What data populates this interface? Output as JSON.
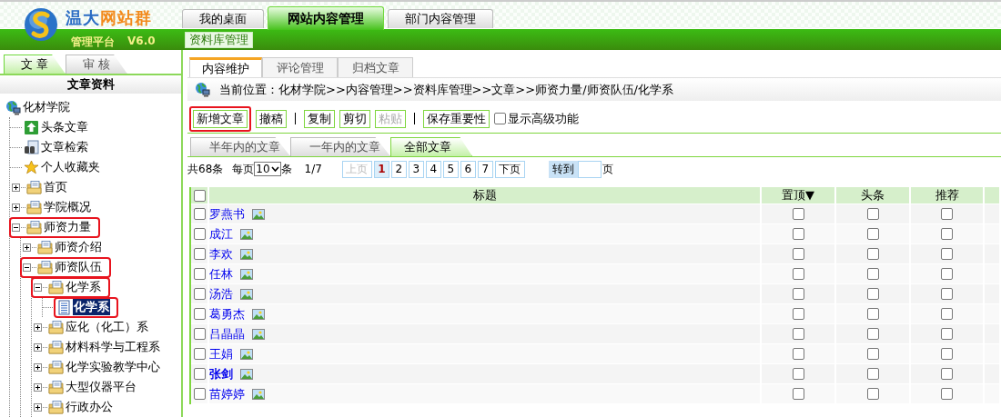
{
  "brand": {
    "name": [
      "温大",
      "网站群"
    ],
    "subtitle": "管理平台",
    "version": "V6.0"
  },
  "top_tabs": [
    {
      "label": "我的桌面",
      "selected": false
    },
    {
      "label": "网站内容管理",
      "selected": true
    },
    {
      "label": "部门内容管理",
      "selected": false
    }
  ],
  "sub_nav": [
    "资料库管理"
  ],
  "sidebar": {
    "tabs": [
      {
        "label": "文 章",
        "selected": true
      },
      {
        "label": "审 核",
        "selected": false
      }
    ],
    "heading": "文章资料",
    "tree": [
      {
        "label": "化材学院",
        "kind": "globe",
        "selected": false,
        "children": [
          {
            "label": "头条文章",
            "kind": "top",
            "highlighted": false,
            "selected": false
          },
          {
            "label": "文章检索",
            "kind": "search",
            "highlighted": false,
            "selected": false
          },
          {
            "label": "个人收藏夹",
            "kind": "star",
            "highlighted": false,
            "selected": false
          },
          {
            "label": "首页",
            "kind": "folder",
            "expanded": false,
            "highlighted": false,
            "selected": false
          },
          {
            "label": "学院概况",
            "kind": "folder",
            "expanded": false,
            "highlighted": false,
            "selected": false
          },
          {
            "label": "师资力量",
            "kind": "folder",
            "expanded": true,
            "highlighted": true,
            "selected": false,
            "children": [
              {
                "label": "师资介绍",
                "kind": "folder",
                "expanded": false,
                "highlighted": false,
                "selected": false
              },
              {
                "label": "师资队伍",
                "kind": "folder",
                "expanded": true,
                "highlighted": true,
                "selected": false,
                "children": [
                  {
                    "label": "化学系",
                    "kind": "folder",
                    "expanded": true,
                    "highlighted": true,
                    "selected": false,
                    "children": [
                      {
                        "label": "化学系",
                        "kind": "doc",
                        "highlighted": true,
                        "selected": true
                      }
                    ]
                  },
                  {
                    "label": "应化（化工）系",
                    "kind": "folder",
                    "expanded": false,
                    "highlighted": false,
                    "selected": false
                  },
                  {
                    "label": "材料科学与工程系",
                    "kind": "folder",
                    "expanded": false,
                    "highlighted": false,
                    "selected": false
                  },
                  {
                    "label": "化学实验教学中心",
                    "kind": "folder",
                    "expanded": false,
                    "highlighted": false,
                    "selected": false
                  },
                  {
                    "label": "大型仪器平台",
                    "kind": "folder",
                    "expanded": false,
                    "highlighted": false,
                    "selected": false
                  },
                  {
                    "label": "行政办公",
                    "kind": "folder",
                    "expanded": false,
                    "highlighted": false,
                    "selected": false
                  }
                ]
              }
            ]
          }
        ]
      }
    ]
  },
  "content_tabs": [
    {
      "label": "内容维护",
      "selected": true
    },
    {
      "label": "评论管理",
      "selected": false
    },
    {
      "label": "归档文章",
      "selected": false
    }
  ],
  "breadcrumb": "当前位置：化材学院>>内容管理>>资料库管理>>文章>>师资力量/师资队伍/化学系",
  "toolbar": [
    {
      "kind": "button",
      "label": "新增文章",
      "highlighted": true,
      "disabled": false
    },
    {
      "kind": "button",
      "label": "撤稿",
      "highlighted": false,
      "disabled": false
    },
    {
      "kind": "separator"
    },
    {
      "kind": "button",
      "label": "复制",
      "highlighted": false,
      "disabled": false
    },
    {
      "kind": "button",
      "label": "剪切",
      "highlighted": false,
      "disabled": false
    },
    {
      "kind": "button",
      "label": "粘贴",
      "highlighted": false,
      "disabled": true
    },
    {
      "kind": "separator"
    },
    {
      "kind": "button",
      "label": "保存重要性",
      "highlighted": false,
      "disabled": false
    },
    {
      "kind": "checkbox",
      "label": "显示高级功能",
      "checked": false
    }
  ],
  "range_tabs": [
    {
      "label": "半年内的文章",
      "selected": false
    },
    {
      "label": "一年内的文章",
      "selected": false
    },
    {
      "label": "全部文章",
      "selected": true
    }
  ],
  "pagination": {
    "total": "共68条",
    "per_page_label": "每页",
    "per_page": "10",
    "per_page_unit": "条",
    "position": "1/7",
    "prev": {
      "label": "上页",
      "disabled": true
    },
    "pages": [
      {
        "label": "1",
        "selected": true
      },
      {
        "label": "2",
        "selected": false
      },
      {
        "label": "3",
        "selected": false
      },
      {
        "label": "4",
        "selected": false
      },
      {
        "label": "5",
        "selected": false
      },
      {
        "label": "6",
        "selected": false
      },
      {
        "label": "7",
        "selected": false
      }
    ],
    "next": {
      "label": "下页",
      "disabled": false
    },
    "goto": "转到",
    "goto_unit": "页"
  },
  "table": {
    "select_all": false,
    "columns": [
      "标题",
      "置顶▼",
      "头条",
      "推荐"
    ],
    "rows": [
      {
        "checked": false,
        "title": "罗燕书",
        "bold": false,
        "top": false,
        "headline": false,
        "recommend": false
      },
      {
        "checked": false,
        "title": "成江",
        "bold": false,
        "top": false,
        "headline": false,
        "recommend": false
      },
      {
        "checked": false,
        "title": "李欢",
        "bold": false,
        "top": false,
        "headline": false,
        "recommend": false
      },
      {
        "checked": false,
        "title": "任林",
        "bold": false,
        "top": false,
        "headline": false,
        "recommend": false
      },
      {
        "checked": false,
        "title": "汤浩",
        "bold": false,
        "top": false,
        "headline": false,
        "recommend": false
      },
      {
        "checked": false,
        "title": "葛勇杰",
        "bold": false,
        "top": false,
        "headline": false,
        "recommend": false
      },
      {
        "checked": false,
        "title": "吕晶晶",
        "bold": false,
        "top": false,
        "headline": false,
        "recommend": false
      },
      {
        "checked": false,
        "title": "王娟",
        "bold": false,
        "top": false,
        "headline": false,
        "recommend": false
      },
      {
        "checked": false,
        "title": "张剑",
        "bold": true,
        "top": false,
        "headline": false,
        "recommend": false
      },
      {
        "checked": false,
        "title": "苗婷婷",
        "bold": false,
        "top": false,
        "headline": false,
        "recommend": false
      }
    ]
  }
}
